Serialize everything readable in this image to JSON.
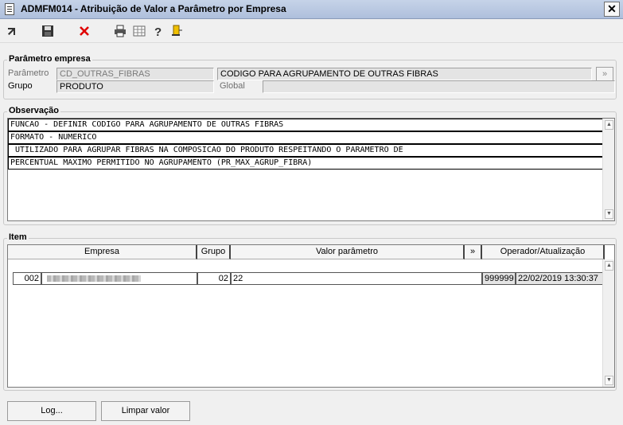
{
  "window": {
    "title": "ADMFM014 - Atribuição de Valor a Parâmetro por Empresa",
    "close_label": "✕"
  },
  "toolbar": {
    "icons": [
      "select-icon",
      "save-icon",
      "delete-icon",
      "print-icon",
      "table-icon",
      "help-icon",
      "exit-icon"
    ]
  },
  "parametro_group": {
    "title": "Parâmetro empresa",
    "parametro_label": "Parâmetro",
    "parametro_code": "CD_OUTRAS_FIBRAS",
    "parametro_desc": "CODIGO PARA AGRUPAMENTO DE OUTRAS FIBRAS",
    "grupo_label": "Grupo",
    "grupo_value": "PRODUTO",
    "global_label": "Global",
    "global_value": "",
    "expand_label": "»"
  },
  "observacao_group": {
    "title": "Observação",
    "lines": [
      "FUNCAO - DEFINIR CODIGO PARA AGRUPAMENTO DE OUTRAS FIBRAS",
      "FORMATO - NUMERICO",
      " UTILIZADO PARA AGRUPAR FIBRAS NA COMPOSICAO DO PRODUTO RESPEITANDO O PARAMETRO DE",
      "PERCENTUAL MAXIMO PERMITIDO NO AGRUPAMENTO (PR_MAX_AGRUP_FIBRA)"
    ]
  },
  "item_group": {
    "title": "Item",
    "columns": [
      "Empresa",
      "Grupo",
      "Valor parâmetro",
      "»",
      "Operador/Atualização"
    ],
    "rows": [
      {
        "empresa_code": "002",
        "grupo": "02",
        "valor": "22",
        "operador": "999999",
        "atualizacao": "22/02/2019 13:30:37"
      }
    ]
  },
  "buttons": {
    "log": "Log...",
    "limpar": "Limpar valor"
  }
}
